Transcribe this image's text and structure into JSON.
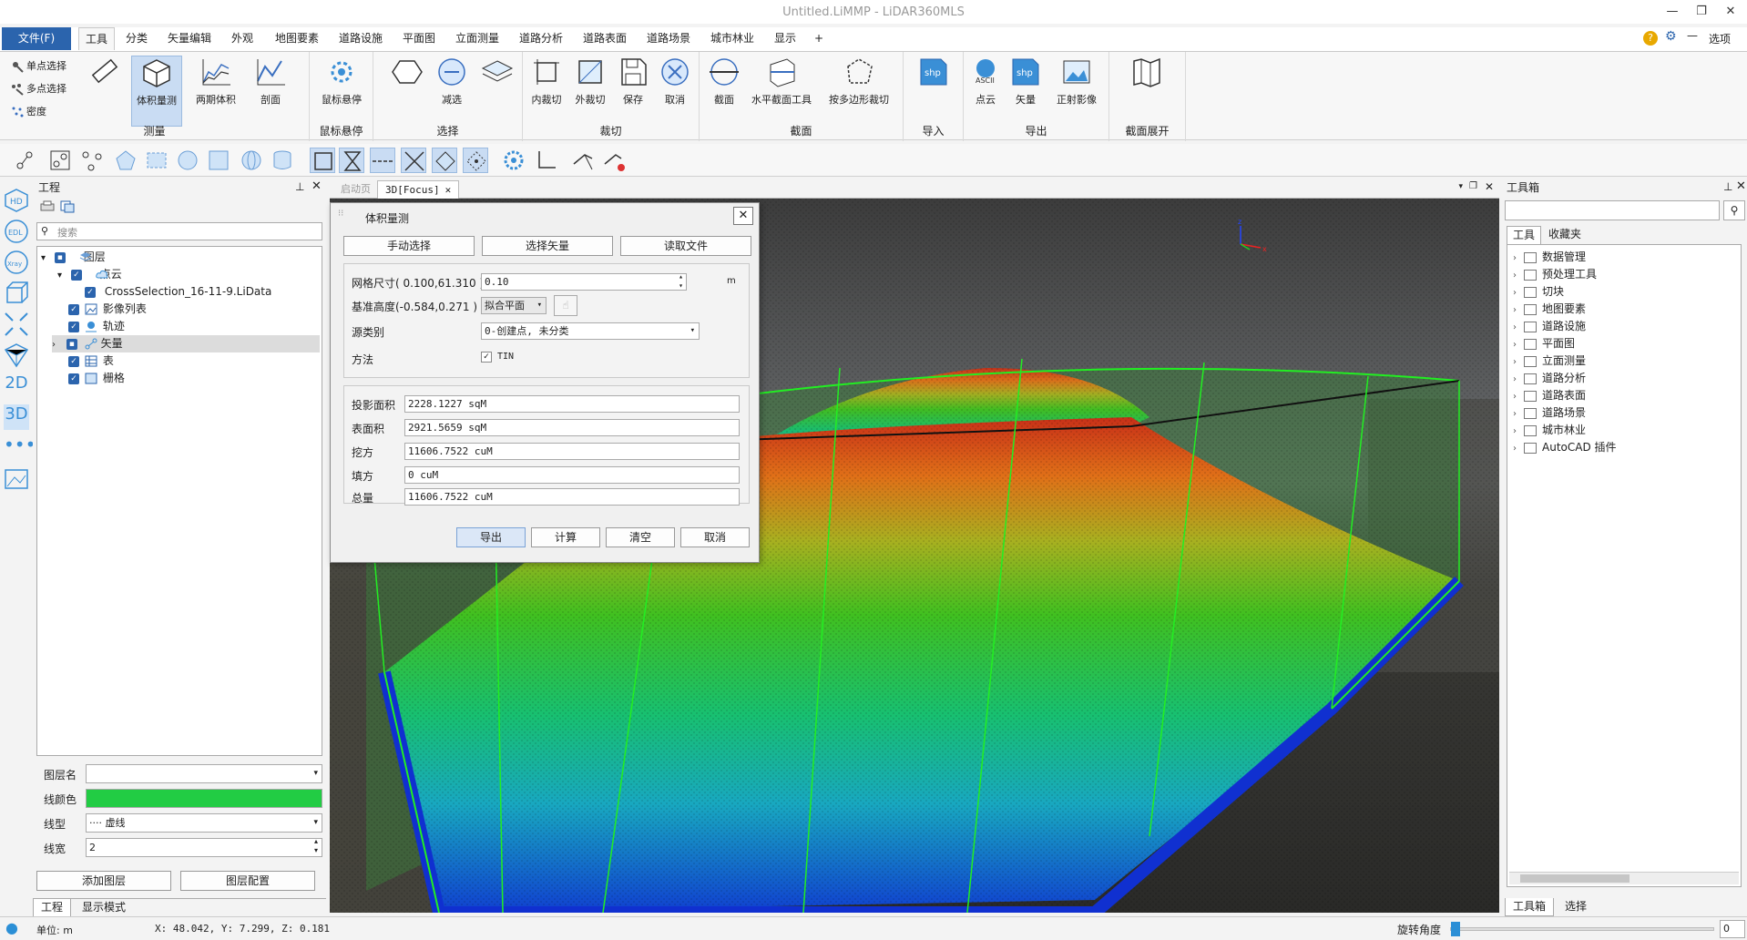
{
  "window": {
    "title": "Untitled.LiMMP - LiDAR360MLS",
    "min": "—",
    "max": "❐",
    "close": "✕"
  },
  "menu": {
    "file": "文件(F)",
    "tabs": [
      "工具",
      "分类",
      "矢量编辑",
      "外观",
      "地图要素",
      "道路设施",
      "平面图",
      "立面测量",
      "道路分析",
      "道路表面",
      "道路场景",
      "城市林业",
      "显示",
      "+"
    ],
    "options": "选项"
  },
  "ribbon": {
    "measure": {
      "label": "测量",
      "single_select": "单点选择",
      "multi_select": "多点选择",
      "density": "密度",
      "volume": "体积量测",
      "two_period": "两期体积",
      "profile": "剖面"
    },
    "hover": {
      "label": "鼠标悬停",
      "btn": "鼠标悬停"
    },
    "select": {
      "label": "选择",
      "subtract": "减选"
    },
    "clip": {
      "label": "裁切",
      "inner": "内裁切",
      "outer": "外裁切",
      "save": "保存",
      "cancel": "取消"
    },
    "section": {
      "label": "截面",
      "section": "截面",
      "horizontal": "水平截面工具",
      "polygon": "按多边形裁切"
    },
    "import": {
      "label": "导入"
    },
    "export": {
      "label": "导出",
      "pointcloud": "点云",
      "vector": "矢量",
      "ortho": "正射影像"
    },
    "unfold": {
      "label": "截面展开"
    }
  },
  "project": {
    "title": "工程",
    "search_placeholder": "搜索",
    "layers": "图层",
    "pointcloud": "点云",
    "file": "CrossSelection_16-11-9.LiData",
    "imagelist": "影像列表",
    "track": "轨迹",
    "vector": "矢量",
    "table": "表",
    "raster": "栅格",
    "props": {
      "layer_name_label": "图层名",
      "layer_name": "",
      "line_color_label": "线颜色",
      "line_color": "#22cc44",
      "line_type_label": "线型",
      "line_type": "···· 虚线",
      "line_width_label": "线宽",
      "line_width": "2"
    },
    "add_layer": "添加图层",
    "layer_config": "图层配置",
    "tabs": [
      "工程",
      "显示模式"
    ]
  },
  "left_strip": [
    "2D",
    "3D"
  ],
  "doc_tabs": [
    "启动页",
    "3D[Focus]"
  ],
  "dialog": {
    "title": "体积量测",
    "manual_select": "手动选择",
    "select_vector": "选择矢量",
    "read_file": "读取文件",
    "grid_size_label": "网格尺寸( 0.100,61.310 )",
    "grid_size": "0.10",
    "grid_unit": "m",
    "base_height_label": "基准高度(-0.584,0.271 )",
    "base_height": "拟合平面",
    "source_class_label": "源类别",
    "source_class": "0-创建点, 未分类",
    "method_label": "方法",
    "method_tin": "TIN",
    "projected_area_label": "投影面积",
    "projected_area": "2228.1227 sqM",
    "surface_area_label": "表面积",
    "surface_area": "2921.5659 sqM",
    "cut_label": "挖方",
    "cut": "11606.7522 cuM",
    "fill_label": "填方",
    "fill": "0 cuM",
    "total_label": "总量",
    "total": "11606.7522 cuM",
    "export": "导出",
    "compute": "计算",
    "clear": "清空",
    "cancel": "取消"
  },
  "toolbox": {
    "title": "工具箱",
    "tabs": [
      "工具",
      "收藏夹"
    ],
    "items": [
      "数据管理",
      "预处理工具",
      "切块",
      "地图要素",
      "道路设施",
      "平面图",
      "立面测量",
      "道路分析",
      "道路表面",
      "道路场景",
      "城市林业",
      "AutoCAD 插件"
    ],
    "bottom_tabs": [
      "工具箱",
      "选择"
    ]
  },
  "status": {
    "unit": "单位: m",
    "coords": "X: 48.042, Y: 7.299, Z: 0.181",
    "rotation_label": "旋转角度",
    "rotation_value": "0",
    "rotation_fraction": 0.0
  },
  "colors": {
    "accent": "#2b64ad",
    "line_green": "#22cc44"
  }
}
